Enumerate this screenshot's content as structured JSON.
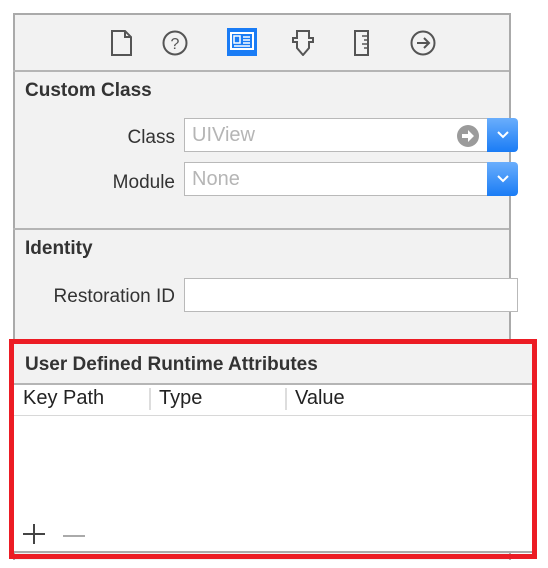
{
  "toolbar": {
    "icons": [
      "file-icon",
      "help-icon",
      "identity-icon",
      "attributes-icon",
      "size-ruler-icon",
      "connections-icon"
    ],
    "selected": "identity-icon",
    "accent": "#1a7cf5"
  },
  "custom_class": {
    "title": "Custom Class",
    "class_label": "Class",
    "class_placeholder": "UIView",
    "module_label": "Module",
    "module_placeholder": "None"
  },
  "identity": {
    "title": "Identity",
    "restoration_label": "Restoration ID",
    "restoration_value": ""
  },
  "runtime_attributes": {
    "title": "User Defined Runtime Attributes",
    "columns": [
      "Key Path",
      "Type",
      "Value"
    ],
    "rows": [],
    "add_label": "+",
    "remove_label": "−",
    "highlight_color": "#ec1c24"
  }
}
